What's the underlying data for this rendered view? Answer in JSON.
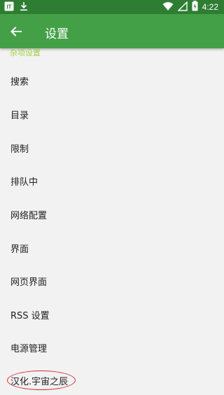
{
  "status_bar": {
    "time": "4:22",
    "icons": [
      "sim-icon",
      "download-icon",
      "wifi-icon",
      "signal-icon",
      "battery-icon"
    ]
  },
  "app_bar": {
    "title": "设置",
    "back_icon": "arrow-left-icon"
  },
  "section": {
    "header": "杂项设置"
  },
  "items": [
    {
      "label": "搜索"
    },
    {
      "label": "目录"
    },
    {
      "label": "限制"
    },
    {
      "label": "排队中"
    },
    {
      "label": "网络配置"
    },
    {
      "label": "界面"
    },
    {
      "label": "网页界面"
    },
    {
      "label": "RSS 设置"
    },
    {
      "label": "电源管理"
    },
    {
      "label": "汉化.宇宙之辰"
    }
  ],
  "colors": {
    "status_bar": "#2e7d32",
    "app_bar": "#43a047",
    "section_header": "#9acd32",
    "annotation": "#d32f2f"
  }
}
